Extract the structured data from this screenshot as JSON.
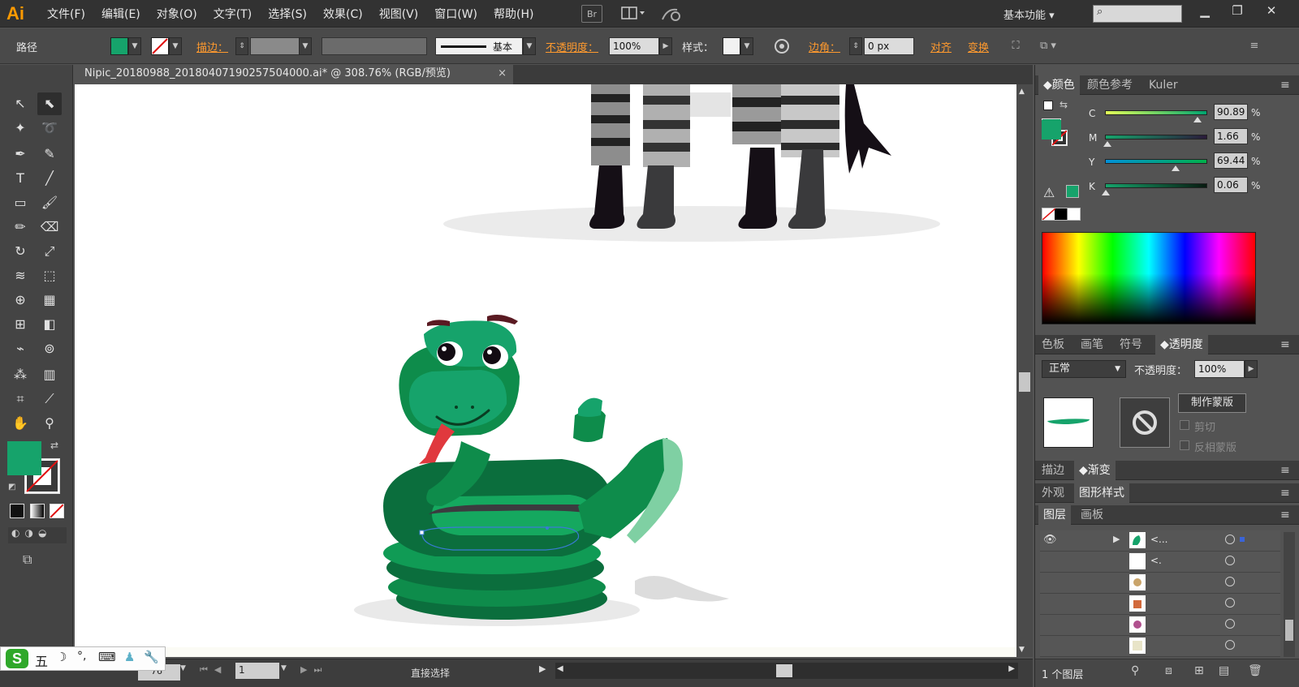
{
  "app": {
    "logo": "Ai"
  },
  "menu": [
    "文件(F)",
    "编辑(E)",
    "对象(O)",
    "文字(T)",
    "选择(S)",
    "效果(C)",
    "视图(V)",
    "窗口(W)",
    "帮助(H)"
  ],
  "menubar_icons": {
    "bridge": "Br"
  },
  "workspace": {
    "label": "基本功能"
  },
  "controlbar": {
    "object_type": "路径",
    "stroke_label": "描边",
    "stroke_style": "基本",
    "opacity_label": "不透明度",
    "opacity_value": "100%",
    "style_label": "样式",
    "corner_label": "边角",
    "corner_value": "0 px",
    "align_label": "对齐",
    "transform_label": "变换"
  },
  "colors": {
    "fill": "#16a36b",
    "accent_orange": "#ff9a2e"
  },
  "document": {
    "tab_title": "Nipic_20180988_20180407190257504000.ai* @ 308.76% (RGB/预览)"
  },
  "statusbar": {
    "artboard": "1",
    "tool_name": "直接选择",
    "zoom_partial": "76"
  },
  "ime": {
    "label": "五"
  },
  "color_panel": {
    "tabs": [
      "颜色",
      "颜色参考",
      "Kuler"
    ],
    "channels": [
      {
        "label": "C",
        "value": "90.89",
        "unit": "%",
        "fraction": 0.9089
      },
      {
        "label": "M",
        "value": "1.66",
        "unit": "%",
        "fraction": 0.0166
      },
      {
        "label": "Y",
        "value": "69.44",
        "unit": "%",
        "fraction": 0.6944
      },
      {
        "label": "K",
        "value": "0.06",
        "unit": "%",
        "fraction": 0.0006
      }
    ]
  },
  "transparency_panel": {
    "tabs": [
      "色板",
      "画笔",
      "符号",
      "透明度"
    ],
    "blend_mode": "正常",
    "opacity_label": "不透明度：",
    "opacity_value": "100%",
    "make_mask": "制作蒙版",
    "clip": "剪切",
    "invert_mask": "反相蒙版"
  },
  "stroke_gradient_tabs": [
    "描边",
    "渐变"
  ],
  "appearance_tabs": [
    "外观",
    "图形样式"
  ],
  "layers_panel": {
    "tabs": [
      "图层",
      "画板"
    ],
    "rows": [
      {
        "name": "<...",
        "expanded": true
      },
      {
        "name": "<."
      },
      {
        "name": ""
      },
      {
        "name": ""
      },
      {
        "name": ""
      },
      {
        "name": ""
      }
    ],
    "footer": "1 个图层"
  }
}
